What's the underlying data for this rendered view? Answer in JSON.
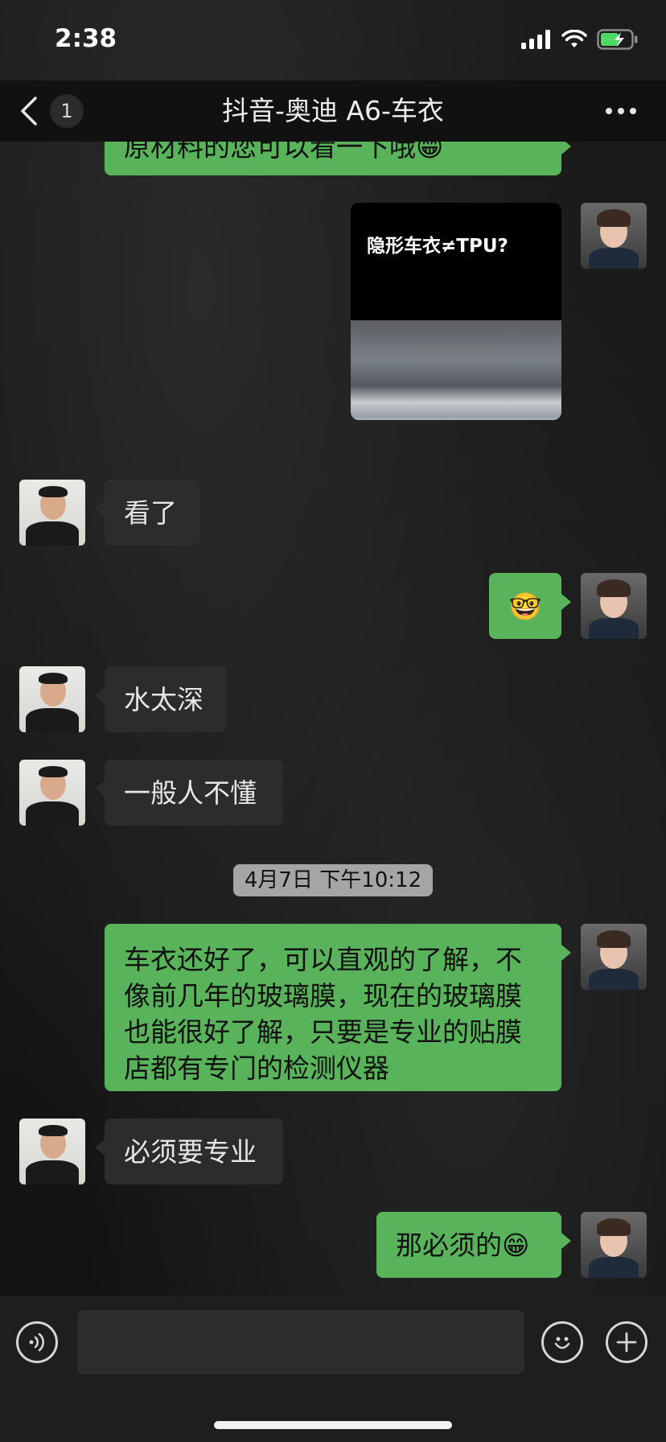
{
  "status_bar": {
    "time": "2:38"
  },
  "nav": {
    "back_badge": "1",
    "title": "抖音-奥迪 A6-车衣"
  },
  "messages": {
    "top_partial": "原材料的您可以看一下哦",
    "video_title": "隐形车衣≠TPU?",
    "m1": "看了",
    "m2_emoji": "🤓",
    "m3": "水太深",
    "m4": "一般人不懂",
    "timestamp": "4月7日 下午10:12",
    "m5": "车衣还好了，可以直观的了解，不像前几年的玻璃膜，现在的玻璃膜也能很好了解，只要是专业的贴膜店都有专门的检测仪器",
    "m6": "必须要专业",
    "m7": "那必须的",
    "grin": "😁"
  },
  "input": {
    "placeholder": ""
  },
  "colors": {
    "outgoing_bubble": "#59b35a",
    "incoming_bubble": "#2c2c2c",
    "timestamp_bg": "#a5a5a5"
  }
}
